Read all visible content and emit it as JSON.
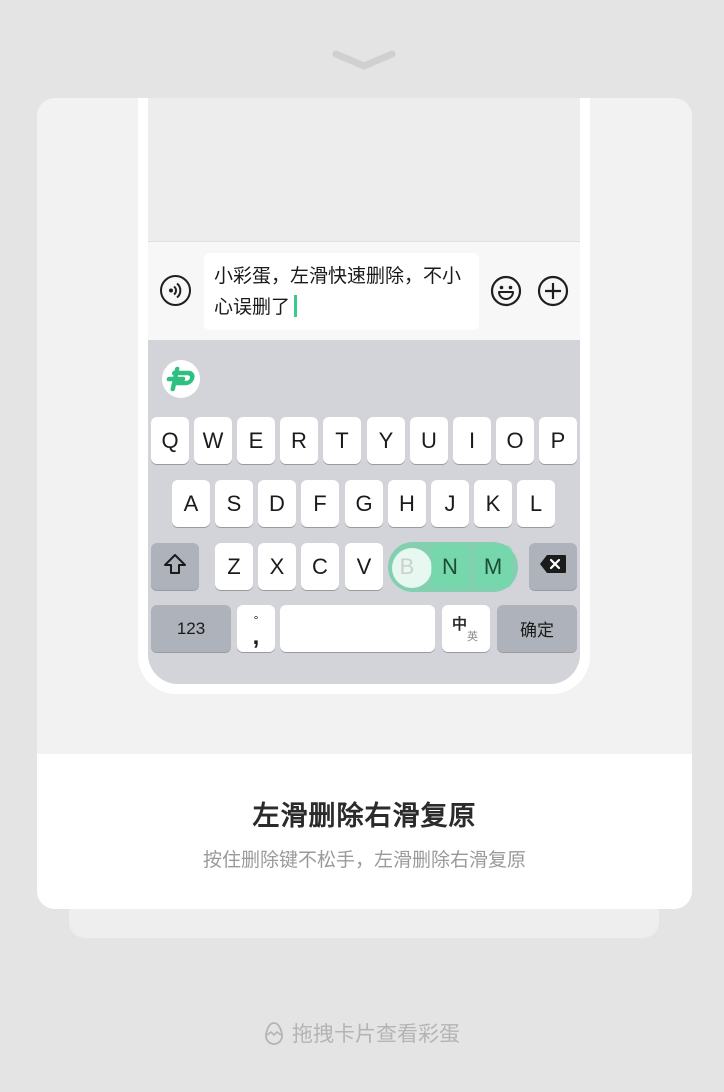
{
  "overlay": {
    "collapse_icon": "chevron-down-icon"
  },
  "demo": {
    "message_text": "小彩蛋，左滑快速删除，不小心误删了",
    "input_icons": [
      "voice-icon",
      "emoji-icon",
      "plus-icon"
    ],
    "accent_color": "#3cc98e",
    "keyboard": {
      "logo_icon": "keyboard-logo-icon",
      "row1": [
        "Q",
        "W",
        "E",
        "R",
        "T",
        "Y",
        "U",
        "I",
        "O",
        "P"
      ],
      "row2": [
        "A",
        "S",
        "D",
        "F",
        "G",
        "H",
        "J",
        "K",
        "L"
      ],
      "row3": [
        "Z",
        "X",
        "C",
        "V",
        "B",
        "N",
        "M"
      ],
      "shift_icon": "shift-icon",
      "backspace_icon": "backspace-icon",
      "numbers_label": "123",
      "punct_top": "°",
      "punct_bottom": ",",
      "lang_top": "中",
      "lang_bottom": "英",
      "confirm_label": "确定",
      "swipe_highlighted": [
        "B",
        "N",
        "M"
      ]
    }
  },
  "caption": {
    "title": "左滑删除右滑复原",
    "subtitle": "按住删除键不松手，左滑删除右滑复原"
  },
  "hint": {
    "icon": "egg-icon",
    "text": "拖拽卡片查看彩蛋"
  }
}
